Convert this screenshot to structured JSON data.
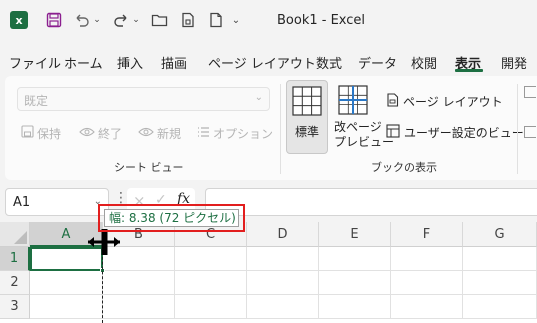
{
  "titlebar": {
    "title": "Book1  -  Excel",
    "icons": [
      "excel-logo",
      "save-icon",
      "undo-icon",
      "redo-icon",
      "open-folder-icon",
      "new-file-icon",
      "blank-page-icon"
    ]
  },
  "tabs": [
    "ファイル",
    "ホーム",
    "挿入",
    "描画",
    "ページ レイアウト",
    "数式",
    "データ",
    "校閲",
    "表示",
    "開発"
  ],
  "active_tab": "表示",
  "ribbon": {
    "sheet_view": {
      "dropdown_value": "既定",
      "keep": "保持",
      "exit": "終了",
      "new": "新規",
      "options": "オプション",
      "group_label": "シート ビュー"
    },
    "workbook_views": {
      "normal": "標準",
      "page_break_line1": "改ページ",
      "page_break_line2": "プレビュー",
      "page_layout": "ページ レイアウト",
      "custom_views": "ユーザー設定のビュー",
      "group_label": "ブックの表示"
    }
  },
  "formula_bar": {
    "name_box": "A1",
    "fx": "fx",
    "formula": ""
  },
  "grid": {
    "columns": [
      "A",
      "B",
      "C",
      "D",
      "E",
      "F",
      "G"
    ],
    "rows": [
      "1",
      "2",
      "3"
    ],
    "selected_cell": "A1"
  },
  "tooltip": {
    "text": "幅: 8.38 (72 ピクセル)"
  },
  "colors": {
    "accent": "#1d6f42",
    "highlight": "#e21e1e"
  }
}
